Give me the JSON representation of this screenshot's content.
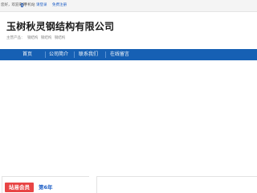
{
  "topbar": {
    "greeting": "您好，欢迎来到",
    "mobile_label": "手机站",
    "login_label": "请登录",
    "register_label": "免费注册"
  },
  "company": {
    "name": "玉树秋灵钢结构有限公司",
    "products_label": "主营产品：",
    "products": [
      "钢结构",
      "钢结构",
      "钢结构"
    ]
  },
  "nav": {
    "items": [
      {
        "label": "首页"
      },
      {
        "label": "公司简介"
      },
      {
        "label": "联系我们"
      },
      {
        "label": "在线留言"
      }
    ]
  },
  "footer": {
    "badge_label": "站易会员",
    "years_label": "第6年"
  }
}
